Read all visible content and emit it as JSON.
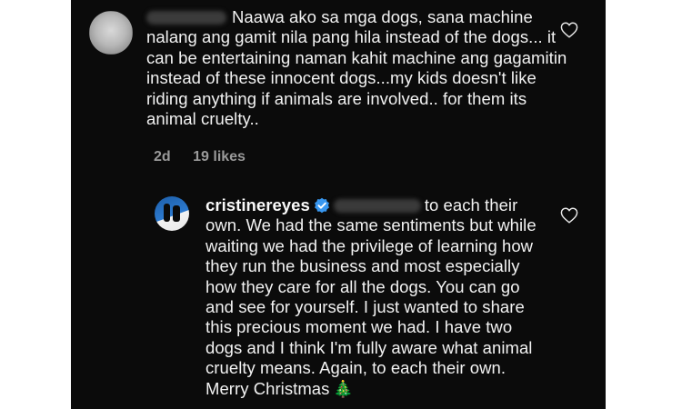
{
  "comments": [
    {
      "username": "",
      "text": "Naawa ako sa mga dogs, sana machine nalang ang gamit nila pang hila instead of the dogs... it can be entertaining naman kahit machine ang gagamitin instead of these innocent dogs...my kids doesn't like riding anything if animals are involved.. for them its animal cruelty..",
      "time": "2d",
      "likes": "19 likes"
    },
    {
      "username": "cristinereyes",
      "verified": true,
      "text_before_mention": "to each their own. We had the same sentiments but while waiting we had the privilege of learning how they run the business and most especially how they care for all the dogs. You can go and see for yourself. I just wanted to share this precious moment we had. I have two dogs and I think I'm fully aware what animal cruelty means. Again, to each their own. Merry Christmas",
      "emoji": "🎄"
    }
  ],
  "icons": {
    "like": "heart-outline-icon",
    "verified": "verified-badge-icon"
  },
  "colors": {
    "background": "#0b0b0b",
    "text": "#f2f2f2",
    "meta": "#9a9a9a",
    "verified": "#3897f0"
  }
}
